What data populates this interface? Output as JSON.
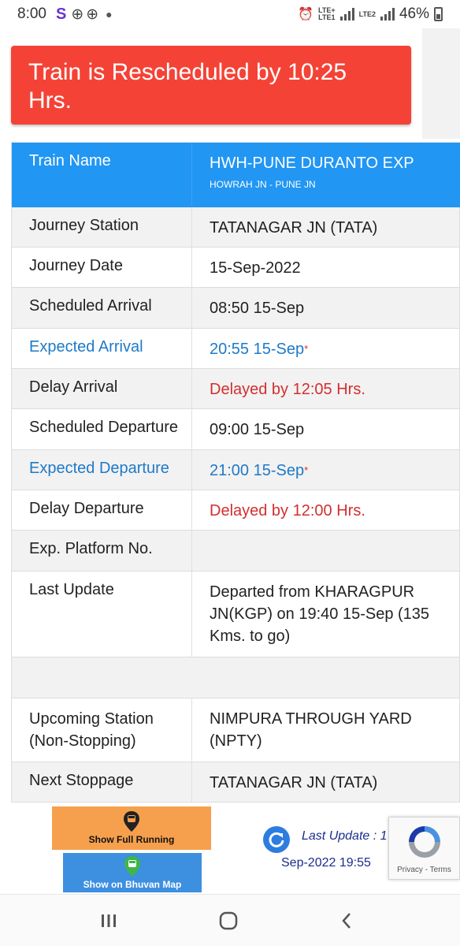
{
  "status_bar": {
    "time": "8:00",
    "app_icon": "S",
    "battery": "46%",
    "sim1": "LTE1",
    "sim2": "LTE2",
    "lte_plus": "LTE+"
  },
  "banner": {
    "text": "Train is Rescheduled by 10:25 Hrs."
  },
  "train": {
    "header_label": "Train Name",
    "name": "HWH-PUNE DURANTO EXP",
    "route": "HOWRAH JN - PUNE JN"
  },
  "rows": [
    {
      "label": "Journey Station",
      "value": "TATANAGAR JN (TATA)"
    },
    {
      "label": "Journey Date",
      "value": "15-Sep-2022"
    },
    {
      "label": "Scheduled Arrival",
      "value": "08:50 15-Sep"
    },
    {
      "label": "Expected Arrival",
      "value": "20:55 15-Sep",
      "marker": "*"
    },
    {
      "label": "Delay Arrival",
      "value": "Delayed by 12:05 Hrs."
    },
    {
      "label": "Scheduled Departure",
      "value": "09:00 15-Sep"
    },
    {
      "label": "Expected Departure",
      "value": "21:00 15-Sep",
      "marker": "*"
    },
    {
      "label": "Delay Departure",
      "value": "Delayed by 12:00 Hrs."
    },
    {
      "label": "Exp. Platform No.",
      "value": ""
    },
    {
      "label": "Last Update",
      "value": "Departed from KHARAGPUR JN(KGP) on 19:40 15-Sep (135 Kms. to go)"
    },
    {
      "label": "",
      "value": ""
    },
    {
      "label": "Upcoming Station (Non-Stopping)",
      "value": "NIMPURA THROUGH YARD (NPTY)"
    },
    {
      "label": "Next Stoppage",
      "value": "TATANAGAR JN (TATA)"
    }
  ],
  "buttons": {
    "full_running": "Show Full Running",
    "bhuvan_map": "Show on Bhuvan Map"
  },
  "last_update": {
    "label": "Last Update : 1",
    "date": "Sep-2022 19:55"
  },
  "recaptcha": {
    "privacy": "Privacy",
    "sep": " - ",
    "terms": "Terms"
  },
  "colors": {
    "banner": "#f44336",
    "header": "#2196f3",
    "expected": "#1e7ac8",
    "delay": "#d32f2f"
  }
}
